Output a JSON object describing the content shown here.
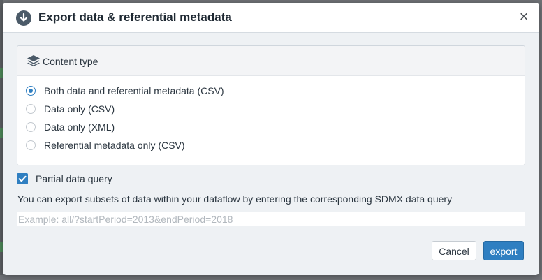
{
  "dialog": {
    "title": "Export data & referential metadata",
    "close_label": "×",
    "icons": {
      "header": "download-circle-icon",
      "section": "layers-icon",
      "checkbox": "checkmark-icon"
    }
  },
  "content_type": {
    "heading": "Content type",
    "options": [
      {
        "label": "Both data and referential metadata (CSV)",
        "selected": true
      },
      {
        "label": "Data only (CSV)",
        "selected": false
      },
      {
        "label": "Data only (XML)",
        "selected": false
      },
      {
        "label": "Referential metadata only (CSV)",
        "selected": false
      }
    ]
  },
  "partial_query": {
    "label": "Partial data query",
    "checked": true,
    "help_text": "You can export subsets of data within your dataflow by entering the corresponding SDMX data query",
    "input_value": "",
    "placeholder": "Example: all/?startPeriod=2013&endPeriod=2018"
  },
  "footer": {
    "cancel_label": "Cancel",
    "export_label": "export"
  },
  "colors": {
    "accent": "#2f7fc1",
    "dialog_bg": "#eef1f4",
    "text": "#2b3640"
  }
}
